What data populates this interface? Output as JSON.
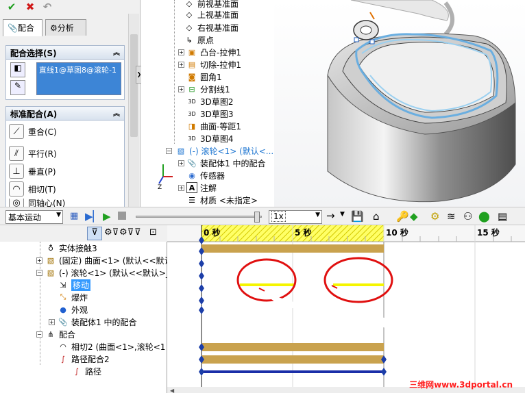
{
  "pm": {
    "tabs": [
      {
        "label": "配合",
        "icon": "paperclip-icon"
      },
      {
        "label": "分析",
        "icon": "analysis-icon"
      }
    ],
    "selection_section": {
      "title": "配合选择(S)",
      "selected_text": "直线1@草图8@滚轮-1"
    },
    "standard_section": {
      "title": "标准配合(A)",
      "mates": [
        "重合(C)",
        "平行(R)",
        "垂直(P)",
        "相切(T)",
        "同轴心(N)"
      ]
    }
  },
  "feature_tree": {
    "items": [
      {
        "label": "前视基准面",
        "icon": "plane-icon"
      },
      {
        "label": "上视基准面",
        "icon": "plane-icon"
      },
      {
        "label": "右视基准面",
        "icon": "plane-icon"
      },
      {
        "label": "原点",
        "icon": "origin-icon"
      },
      {
        "label": "凸台-拉伸1",
        "icon": "boss-extrude-icon"
      },
      {
        "label": "切除-拉伸1",
        "icon": "cut-extrude-icon"
      },
      {
        "label": "圆角1",
        "icon": "fillet-icon"
      },
      {
        "label": "分割线1",
        "icon": "split-line-icon"
      },
      {
        "label": "3D草图2",
        "icon": "3d-sketch-icon"
      },
      {
        "label": "3D草图3",
        "icon": "3d-sketch-icon"
      },
      {
        "label": "曲面-等距1",
        "icon": "offset-surface-icon"
      },
      {
        "label": "3D草图4",
        "icon": "3d-sketch-icon"
      },
      {
        "label": "(-) 滚轮<1> (默认<...",
        "icon": "part-icon"
      },
      {
        "label": "装配体1 中的配合",
        "icon": "mates-folder-icon"
      },
      {
        "label": "传感器",
        "icon": "sensor-icon"
      },
      {
        "label": "注解",
        "icon": "annotation-icon"
      },
      {
        "label": "材质 <未指定>",
        "icon": "material-icon"
      }
    ]
  },
  "motion": {
    "study_type": "基本运动",
    "speed": "1x",
    "tree": [
      {
        "label": "实体接触3",
        "icon": "contact-icon"
      },
      {
        "label": "(固定) 曲面<1> (默认<<默认",
        "icon": "part-icon"
      },
      {
        "label": "(-) 滚轮<1> (默认<<默认>_",
        "icon": "part-icon"
      },
      {
        "label": "移动",
        "icon": "move-icon"
      },
      {
        "label": "爆炸",
        "icon": "explode-icon"
      },
      {
        "label": "外观",
        "icon": "appearance-icon"
      },
      {
        "label": "装配体1 中的配合",
        "icon": "mates-folder-icon"
      },
      {
        "label": "配合",
        "icon": "mates-folder-icon"
      },
      {
        "label": "相切2 (曲面<1>,滚轮<1",
        "icon": "tangent-mate-icon"
      },
      {
        "label": "路径配合2",
        "icon": "path-mate-icon"
      },
      {
        "label": "路径",
        "icon": "path-icon"
      }
    ],
    "time_labels": [
      "0 秒",
      "5 秒",
      "10 秒",
      "15 秒"
    ]
  },
  "watermark": "三维网www.3dportal.cn",
  "colors": {
    "selection_blue": "#3399ff",
    "timeline_gold": "#c9a24e",
    "key_blue": "#1c3ea8",
    "highlight_yellow": "#f5f500",
    "circle_red": "#e01010"
  }
}
